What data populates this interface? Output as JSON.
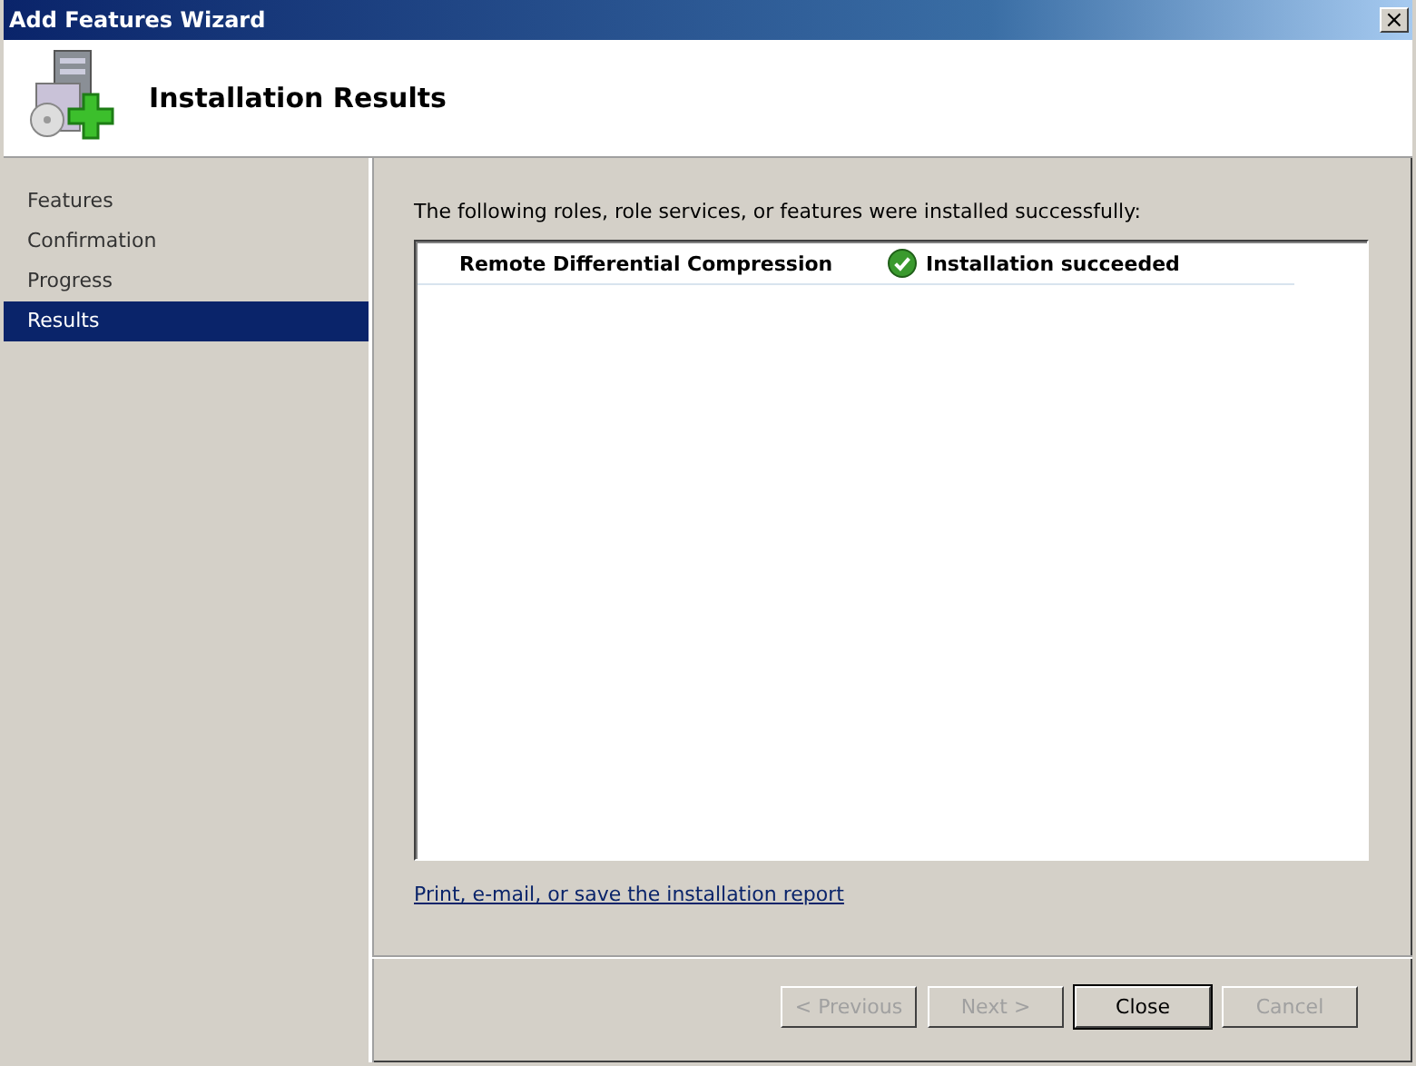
{
  "window": {
    "title": "Add Features Wizard",
    "close": "×"
  },
  "header": {
    "title": "Installation Results"
  },
  "steps": [
    {
      "label": "Features",
      "selected": false
    },
    {
      "label": "Confirmation",
      "selected": false
    },
    {
      "label": "Progress",
      "selected": false
    },
    {
      "label": "Results",
      "selected": true
    }
  ],
  "intro": "The following roles, role services, or features were installed successfully:",
  "results": [
    {
      "name": "Remote Differential Compression",
      "status": "Installation succeeded",
      "succeeded": true
    }
  ],
  "report_link": "Print, e-mail, or save the installation report",
  "buttons": [
    {
      "label": "< Previous",
      "disabled": true,
      "default": false
    },
    {
      "label": "Next >",
      "disabled": true,
      "default": false
    },
    {
      "label": "Close",
      "disabled": false,
      "default": true
    },
    {
      "label": "Cancel",
      "disabled": true,
      "default": false
    }
  ]
}
